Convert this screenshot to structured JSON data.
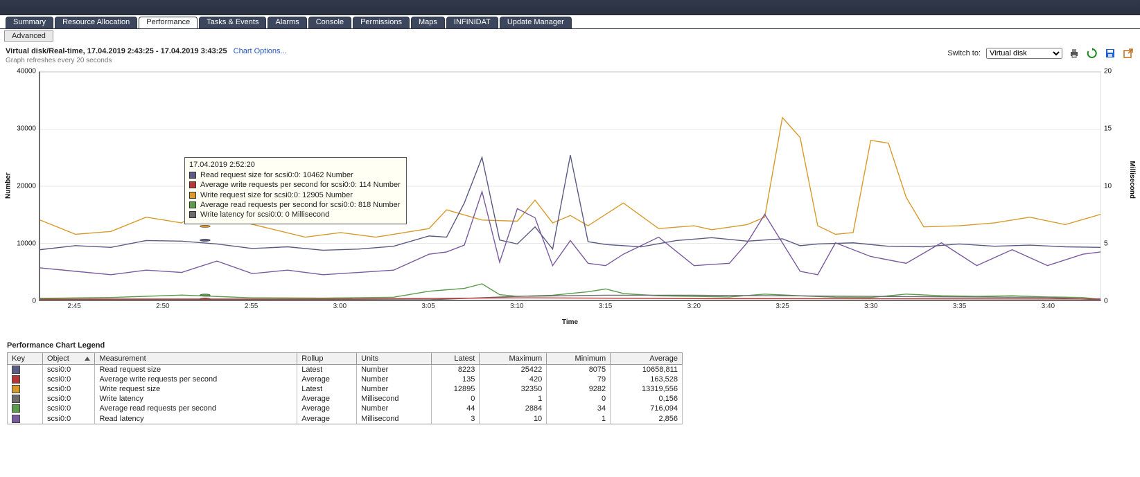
{
  "tabs": [
    "Summary",
    "Resource Allocation",
    "Performance",
    "Tasks & Events",
    "Alarms",
    "Console",
    "Permissions",
    "Maps",
    "INFINIDAT",
    "Update Manager"
  ],
  "active_tab_index": 2,
  "subbar": {
    "advanced": "Advanced"
  },
  "header": {
    "title": "Virtual disk/Real-time, 17.04.2019 2:43:25 - 17.04.2019 3:43:25",
    "chart_options": "Chart Options...",
    "refresh_note": "Graph refreshes every 20 seconds",
    "switch_label": "Switch to:",
    "switch_selected": "Virtual disk"
  },
  "axes": {
    "y_left_label": "Number",
    "y_right_label": "Millisecond",
    "x_label": "Time",
    "y_left_ticks": [
      "0",
      "10000",
      "20000",
      "30000",
      "40000"
    ],
    "y_right_ticks": [
      "0",
      "5",
      "10",
      "15",
      "20"
    ],
    "x_ticks": [
      "2:45",
      "2:50",
      "2:55",
      "3:00",
      "3:05",
      "3:10",
      "3:15",
      "3:20",
      "3:25",
      "3:30",
      "3:35",
      "3:40"
    ]
  },
  "tooltip": {
    "time": "17.04.2019 2:52:20",
    "rows": [
      {
        "color": "#5b5a82",
        "text": "Read request size for scsi0:0: 10462 Number"
      },
      {
        "color": "#b83636",
        "text": "Average write requests per second for scsi0:0: 114 Number"
      },
      {
        "color": "#d79a2b",
        "text": "Write request size for scsi0:0: 12905 Number"
      },
      {
        "color": "#5a9c4a",
        "text": "Average read requests per second for scsi0:0: 818 Number"
      },
      {
        "color": "#6c6c6c",
        "text": "Write latency for scsi0:0: 0 Millisecond"
      }
    ]
  },
  "legend": {
    "title": "Performance Chart Legend",
    "columns": [
      "Key",
      "Object",
      "Measurement",
      "Rollup",
      "Units",
      "Latest",
      "Maximum",
      "Minimum",
      "Average"
    ],
    "rows": [
      {
        "color": "#5b5a82",
        "object": "scsi0:0",
        "measurement": "Read request size",
        "rollup": "Latest",
        "units": "Number",
        "latest": "8223",
        "maximum": "25422",
        "minimum": "8075",
        "average": "10658,811"
      },
      {
        "color": "#b83636",
        "object": "scsi0:0",
        "measurement": "Average write requests per second",
        "rollup": "Average",
        "units": "Number",
        "latest": "135",
        "maximum": "420",
        "minimum": "79",
        "average": "163,528"
      },
      {
        "color": "#d79a2b",
        "object": "scsi0:0",
        "measurement": "Write request size",
        "rollup": "Latest",
        "units": "Number",
        "latest": "12895",
        "maximum": "32350",
        "minimum": "9282",
        "average": "13319,556"
      },
      {
        "color": "#6c6c6c",
        "object": "scsi0:0",
        "measurement": "Write latency",
        "rollup": "Average",
        "units": "Millisecond",
        "latest": "0",
        "maximum": "1",
        "minimum": "0",
        "average": "0,156"
      },
      {
        "color": "#5a9c4a",
        "object": "scsi0:0",
        "measurement": "Average read requests per second",
        "rollup": "Average",
        "units": "Number",
        "latest": "44",
        "maximum": "2884",
        "minimum": "34",
        "average": "716,094"
      },
      {
        "color": "#7b5aa0",
        "object": "scsi0:0",
        "measurement": "Read latency",
        "rollup": "Average",
        "units": "Millisecond",
        "latest": "3",
        "maximum": "10",
        "minimum": "1",
        "average": "2,856"
      }
    ]
  },
  "chart_data": {
    "type": "line",
    "x_range_minutes": [
      163,
      223
    ],
    "x_ticks_minutes": [
      165,
      170,
      175,
      180,
      185,
      190,
      195,
      200,
      205,
      210,
      215,
      220
    ],
    "y_left_lim": [
      0,
      40000
    ],
    "y_right_lim": [
      0,
      20
    ],
    "xlabel": "Time",
    "ylabel_left": "Number",
    "ylabel_right": "Millisecond",
    "series": [
      {
        "name": "Write request size",
        "axis": "left",
        "color": "#d79a2b",
        "x": [
          163,
          165,
          167,
          169,
          171,
          172,
          174,
          176,
          178,
          180,
          182,
          184,
          185,
          186,
          188,
          190,
          191,
          192,
          193,
          194,
          196,
          198,
          200,
          201,
          203,
          204,
          205,
          206,
          207,
          208,
          209,
          210,
          211,
          212,
          213,
          215,
          217,
          219,
          221,
          223
        ],
        "y": [
          14000,
          11500,
          12000,
          14500,
          13500,
          15200,
          14000,
          12500,
          11000,
          11800,
          11000,
          12000,
          12500,
          15800,
          14000,
          13800,
          17500,
          13500,
          14800,
          13000,
          17000,
          12500,
          13000,
          12300,
          13200,
          14500,
          32000,
          28500,
          13000,
          11500,
          11800,
          28000,
          27500,
          18000,
          12800,
          13000,
          13500,
          14500,
          13200,
          15000
        ]
      },
      {
        "name": "Read request size",
        "axis": "left",
        "color": "#5b5a82",
        "x": [
          163,
          165,
          167,
          169,
          171,
          173,
          175,
          177,
          179,
          181,
          183,
          185,
          186,
          187,
          188,
          189,
          190,
          191,
          192,
          193,
          194,
          195,
          197,
          199,
          201,
          203,
          205,
          206,
          207,
          209,
          211,
          213,
          215,
          217,
          219,
          221,
          223
        ],
        "y": [
          8800,
          9500,
          9200,
          10400,
          10300,
          9800,
          9000,
          9300,
          8700,
          8900,
          9400,
          11200,
          11000,
          17000,
          25000,
          10500,
          9800,
          12800,
          8900,
          25400,
          10200,
          9700,
          9300,
          10400,
          10900,
          10300,
          10700,
          9500,
          9800,
          10000,
          9400,
          9300,
          9800,
          9400,
          9600,
          9300,
          9200
        ]
      },
      {
        "name": "Read latency",
        "axis": "right",
        "color": "#7b5aa0",
        "x": [
          163,
          165,
          167,
          169,
          171,
          173,
          175,
          177,
          179,
          181,
          183,
          185,
          186,
          187,
          188,
          189,
          190,
          191,
          192,
          193,
          194,
          195,
          196,
          198,
          200,
          202,
          203,
          204,
          205,
          206,
          207,
          208,
          210,
          212,
          214,
          216,
          218,
          220,
          222,
          223
        ],
        "y": [
          2.8,
          2.5,
          2.2,
          2.6,
          2.4,
          3.4,
          2.3,
          2.6,
          2.2,
          2.4,
          2.6,
          4.0,
          4.2,
          4.8,
          9.5,
          3.3,
          8.0,
          7.2,
          3.0,
          5.2,
          3.2,
          3.0,
          4.0,
          5.5,
          3.0,
          3.2,
          5.0,
          7.5,
          5.0,
          2.5,
          2.2,
          5.0,
          3.8,
          3.2,
          5.0,
          3.0,
          4.4,
          3.0,
          4.0,
          4.2
        ]
      },
      {
        "name": "Average read requests per second",
        "axis": "left",
        "color": "#5a9c4a",
        "x": [
          163,
          167,
          171,
          175,
          179,
          183,
          185,
          187,
          188,
          189,
          190,
          192,
          194,
          195,
          196,
          198,
          200,
          202,
          204,
          206,
          208,
          210,
          212,
          214,
          216,
          218,
          220,
          222,
          223
        ],
        "y": [
          250,
          400,
          820,
          350,
          300,
          450,
          1500,
          2000,
          2800,
          900,
          600,
          800,
          1400,
          1900,
          1100,
          700,
          600,
          500,
          1000,
          700,
          450,
          400,
          1000,
          700,
          600,
          700,
          500,
          400,
          44
        ]
      },
      {
        "name": "Write latency",
        "axis": "right",
        "color": "#6c6c6c",
        "x": [
          163,
          175,
          185,
          190,
          195,
          200,
          210,
          220,
          223
        ],
        "y": [
          0,
          0,
          0,
          0.3,
          0.4,
          0.4,
          0.3,
          0.2,
          0
        ]
      },
      {
        "name": "Average write requests per second",
        "axis": "left",
        "color": "#b83636",
        "x": [
          163,
          170,
          180,
          185,
          190,
          195,
          200,
          210,
          220,
          223
        ],
        "y": [
          120,
          130,
          140,
          220,
          350,
          280,
          200,
          180,
          150,
          135
        ]
      }
    ]
  }
}
